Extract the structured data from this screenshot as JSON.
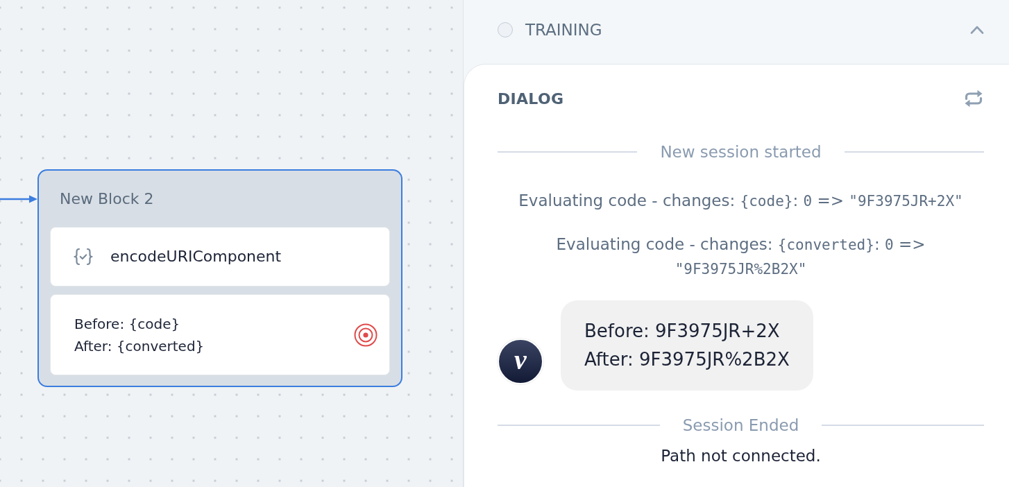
{
  "canvas": {
    "block": {
      "title": "New Block 2",
      "selected": true,
      "steps": [
        {
          "kind": "code",
          "label": "encodeURIComponent"
        },
        {
          "kind": "text",
          "lines": [
            "Before: {code}",
            "After: {converted}"
          ]
        }
      ]
    }
  },
  "panel": {
    "training": {
      "label": "TRAINING",
      "checked": false,
      "expanded": true
    },
    "dialog": {
      "title": "DIALOG",
      "messages": [
        {
          "kind": "divider",
          "text": "New session started"
        },
        {
          "kind": "log",
          "parts": [
            {
              "kind": "text",
              "text": "Evaluating code - changes: "
            },
            {
              "kind": "code",
              "text": "{code}"
            },
            {
              "kind": "text",
              "text": ": "
            },
            {
              "kind": "code",
              "text": "0"
            },
            {
              "kind": "text",
              "text": " => "
            },
            {
              "kind": "code",
              "text": "\"9F3975JR+2X\""
            }
          ]
        },
        {
          "kind": "log",
          "parts": [
            {
              "kind": "text",
              "text": "Evaluating code - changes: "
            },
            {
              "kind": "code",
              "text": "{converted}"
            },
            {
              "kind": "text",
              "text": ": "
            },
            {
              "kind": "code",
              "text": "0"
            },
            {
              "kind": "text",
              "text": " => "
            },
            {
              "kind": "code",
              "text": "\"9F3975JR%2B2X\""
            }
          ]
        },
        {
          "kind": "bot",
          "avatar": "v",
          "lines": [
            "Before: 9F3975JR+2X",
            "After: 9F3975JR%2B2X"
          ]
        },
        {
          "kind": "divider",
          "text": "Session Ended"
        },
        {
          "kind": "notice",
          "text": "Path not connected."
        }
      ]
    }
  }
}
